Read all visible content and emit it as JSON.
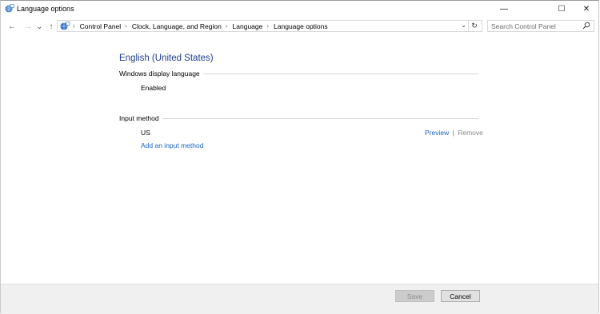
{
  "window": {
    "title": "Language options",
    "minimize_glyph": "—",
    "maximize_glyph": "☐",
    "close_glyph": "✕"
  },
  "nav": {
    "back_glyph": "←",
    "forward_glyph": "→",
    "recent_glyph": "⌄",
    "up_glyph": "↑",
    "breadcrumbs": [
      "Control Panel",
      "Clock, Language, and Region",
      "Language",
      "Language options"
    ],
    "breadcrumb_separator": "›",
    "dropdown_glyph": "⌄",
    "refresh_glyph": "↻"
  },
  "search": {
    "placeholder": "Search Control Panel"
  },
  "language": {
    "name": "English (United States)",
    "display_section_label": "Windows display language",
    "display_status": "Enabled",
    "input_section_label": "Input method",
    "input_methods": [
      {
        "name": "US",
        "preview_label": "Preview",
        "separator": "|",
        "remove_label": "Remove"
      }
    ],
    "add_input_label": "Add an input method"
  },
  "footer": {
    "save_label": "Save",
    "cancel_label": "Cancel"
  },
  "colors": {
    "heading_blue": "#1f3d8f",
    "link_blue": "#1a64c5",
    "footer_bg": "#f0f0f0"
  }
}
